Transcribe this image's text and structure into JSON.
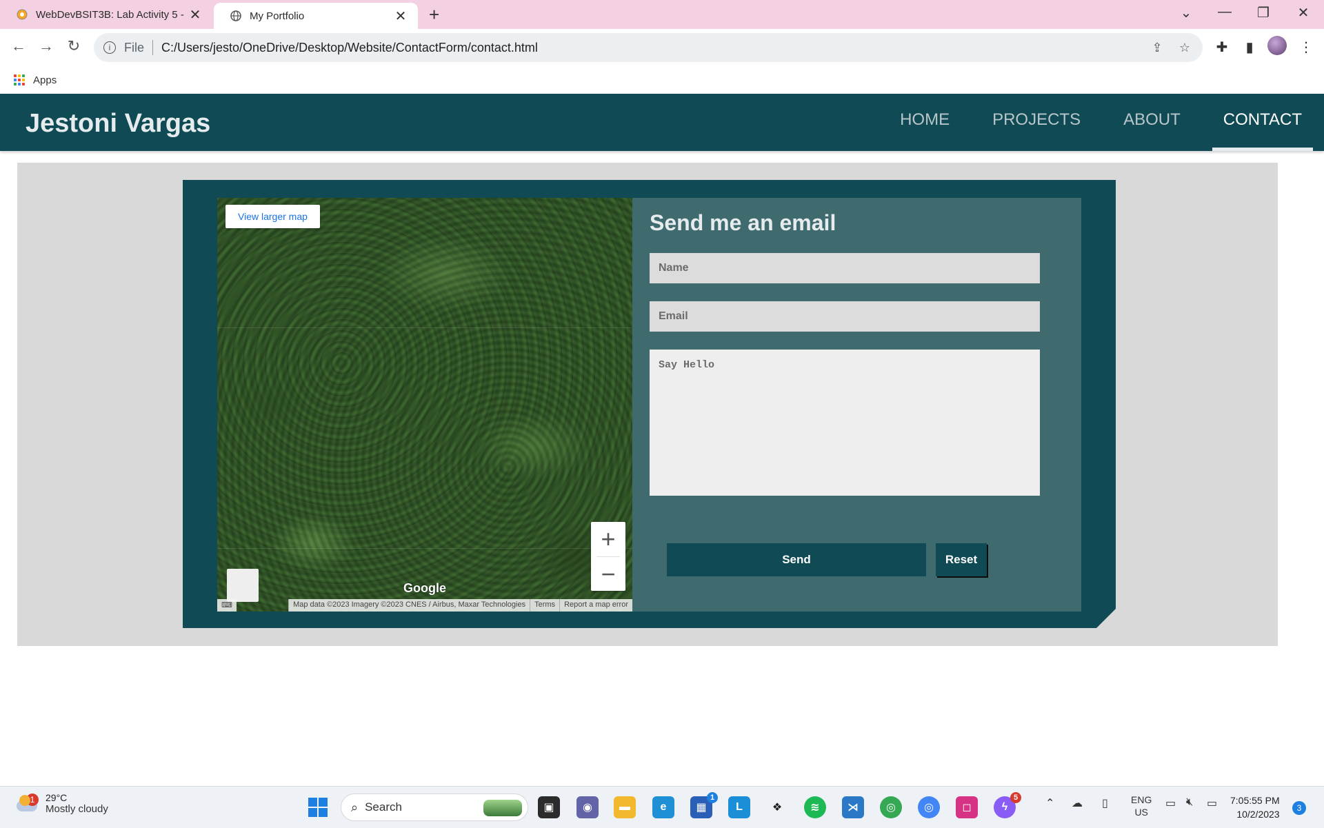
{
  "browser": {
    "tabs": [
      {
        "title": "WebDevBSIT3B: Lab Activity 5 - ",
        "active": false
      },
      {
        "title": "My Portfolio",
        "active": true
      }
    ],
    "new_tab": "+",
    "window_controls": {
      "dropdown": "⌄",
      "minimize": "—",
      "restore": "❐",
      "close": "✕"
    },
    "address": {
      "scheme": "File",
      "url": "C:/Users/jesto/OneDrive/Desktop/Website/ContactForm/contact.html"
    },
    "bookmarks": {
      "apps_label": "Apps"
    }
  },
  "site": {
    "name": "Jestoni Vargas",
    "nav": [
      {
        "label": "HOME",
        "active": false
      },
      {
        "label": "PROJECTS",
        "active": false
      },
      {
        "label": "ABOUT",
        "active": false
      },
      {
        "label": "CONTACT",
        "active": true
      }
    ],
    "colors": {
      "primary": "#0f4a55",
      "panel": "#3f6a6e",
      "background": "#d9d9d9"
    }
  },
  "map": {
    "view_larger": "View larger map",
    "zoom_in": "+",
    "zoom_out": "−",
    "logo": "Google",
    "attribution": {
      "data": "Map data ©2023 Imagery ©2023 CNES / Airbus, Maxar Technologies",
      "terms": "Terms",
      "report": "Report a map error"
    }
  },
  "form": {
    "title": "Send me an email",
    "name_placeholder": "Name",
    "email_placeholder": "Email",
    "message_placeholder": "Say Hello",
    "send_label": "Send",
    "reset_label": "Reset"
  },
  "taskbar": {
    "weather": {
      "temp": "29°C",
      "desc": "Mostly cloudy",
      "badge": "1"
    },
    "search_label": "Search",
    "store_badge": "1",
    "messenger_badge": "5",
    "language": {
      "lang": "ENG",
      "region": "US"
    },
    "clock": {
      "time": "7:05:55 PM",
      "date": "10/2/2023"
    },
    "notifications": "3"
  }
}
